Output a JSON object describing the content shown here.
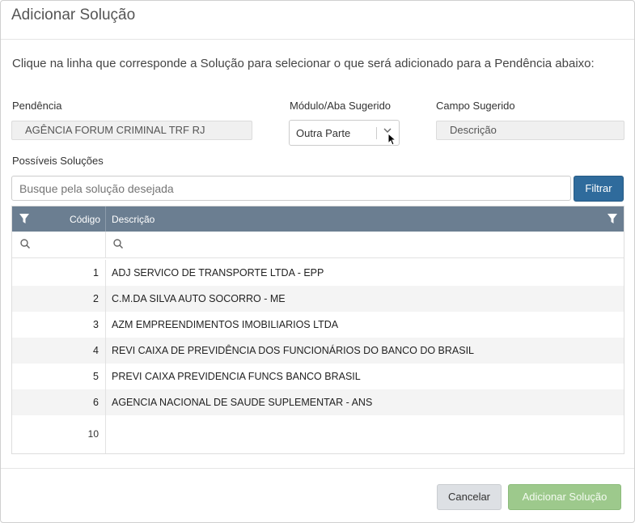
{
  "dialog": {
    "title": "Adicionar Solução",
    "instructions": "Clique na linha que corresponde a Solução para selecionar o que será adicionado para a Pendência abaixo:"
  },
  "fields": {
    "pendencia_label": "Pendência",
    "pendencia_value": "AGÊNCIA FORUM CRIMINAL TRF RJ",
    "modulo_label": "Módulo/Aba Sugerido",
    "modulo_value": "Outra Parte",
    "campo_label": "Campo Sugerido",
    "campo_value": "Descrição"
  },
  "search": {
    "label": "Possíveis Soluções",
    "placeholder": "Busque pela solução desejada",
    "filter_button": "Filtrar"
  },
  "grid": {
    "columns": {
      "code": "Código",
      "description": "Descrição"
    },
    "rows": [
      {
        "code": "1",
        "description": "ADJ SERVICO DE TRANSPORTE LTDA - EPP"
      },
      {
        "code": "2",
        "description": "C.M.DA SILVA AUTO SOCORRO - ME"
      },
      {
        "code": "3",
        "description": "AZM EMPREENDIMENTOS IMOBILIARIOS LTDA"
      },
      {
        "code": "4",
        "description": "REVI CAIXA DE PREVIDÊNCIA DOS FUNCIONÁRIOS DO BANCO DO BRASIL"
      },
      {
        "code": "5",
        "description": "PREVI CAIXA PREVIDENCIA FUNCS BANCO BRASIL"
      },
      {
        "code": "6",
        "description": "AGENCIA NACIONAL DE SAUDE SUPLEMENTAR - ANS"
      }
    ],
    "footer_count": "10"
  },
  "footer": {
    "cancel": "Cancelar",
    "add": "Adicionar Solução"
  },
  "icons": {
    "filter": "filter-icon",
    "search": "search-icon",
    "dropdown": "chevron-down-icon"
  },
  "colors": {
    "header_bg": "#6b7e91",
    "primary_button": "#2f6b9c",
    "add_button_disabled": "#9dc98c",
    "cancel_button": "#dde0e4"
  }
}
